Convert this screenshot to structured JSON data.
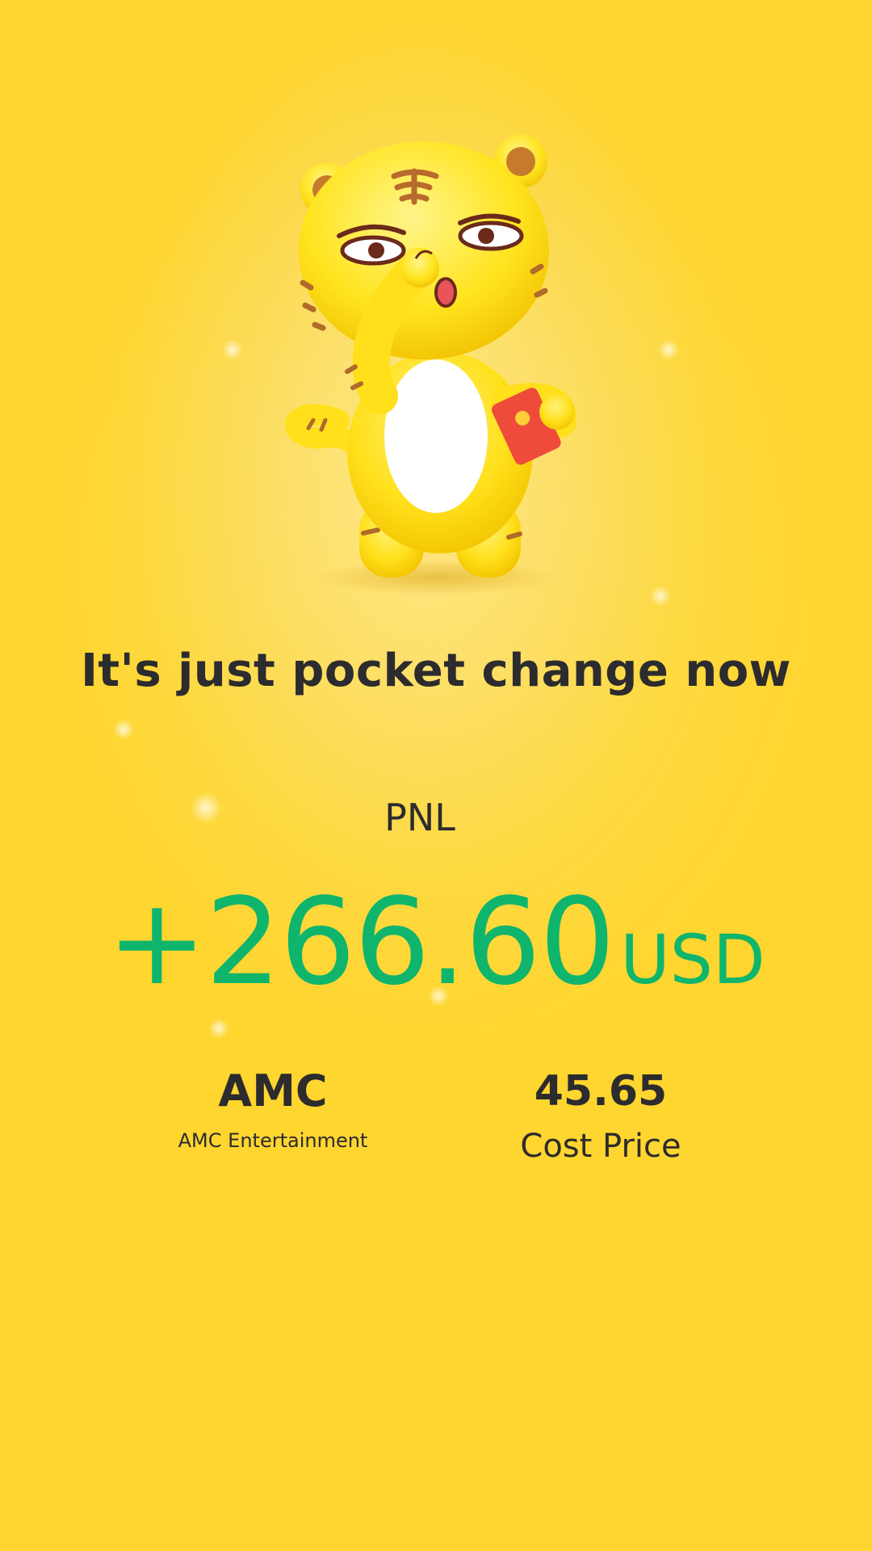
{
  "headline": "It's just pocket change now",
  "pnl": {
    "label": "PNL",
    "amount": "+266.60",
    "currency": "USD"
  },
  "stock": {
    "ticker": "AMC",
    "name": "AMC Entertainment"
  },
  "cost": {
    "value": "45.65",
    "label": "Cost Price"
  },
  "colors": {
    "background": "#fdd632",
    "profit_green": "#0fb56c",
    "text_dark": "#2c2b2e"
  },
  "mascot": {
    "icon": "tiger-mascot-icon"
  }
}
